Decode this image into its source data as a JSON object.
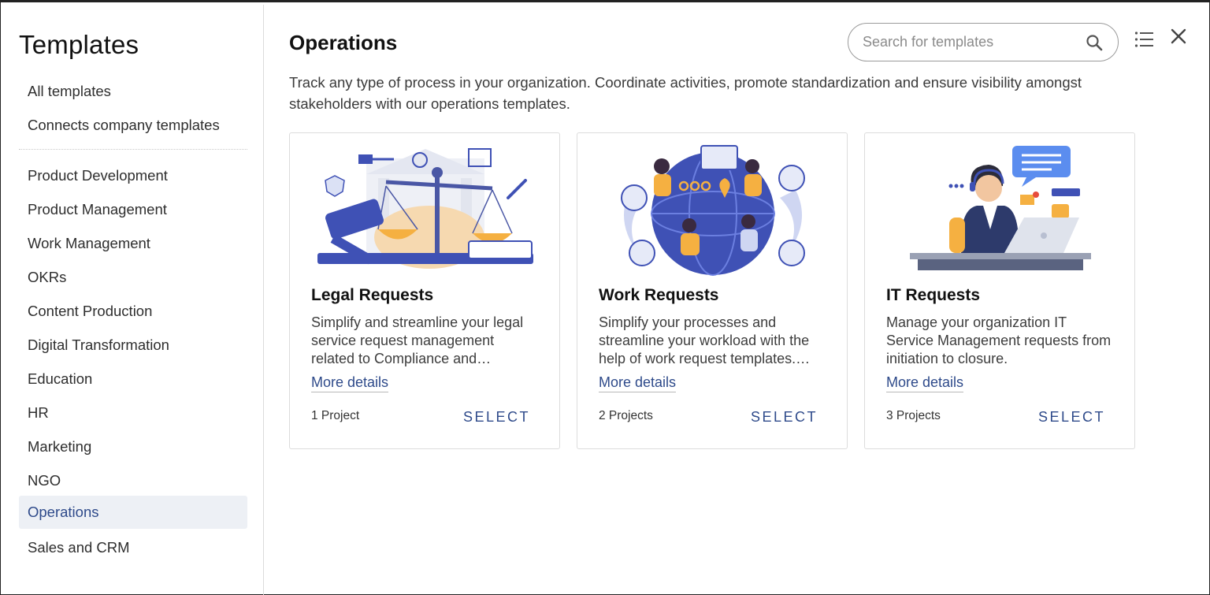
{
  "sidebar": {
    "title": "Templates",
    "top_items": [
      {
        "label": "All templates"
      },
      {
        "label": "Connects company templates"
      }
    ],
    "categories": [
      {
        "label": "Product Development"
      },
      {
        "label": "Product Management"
      },
      {
        "label": "Work Management"
      },
      {
        "label": "OKRs"
      },
      {
        "label": "Content Production"
      },
      {
        "label": "Digital Transformation"
      },
      {
        "label": "Education"
      },
      {
        "label": "HR"
      },
      {
        "label": "Marketing"
      },
      {
        "label": "NGO"
      },
      {
        "label": "Operations",
        "active": true
      },
      {
        "label": "Sales and CRM"
      }
    ]
  },
  "main": {
    "title": "Operations",
    "description": "Track any type of process in your organization. Coordinate activities, promote standardization and ensure visibility amongst stakeholders with our operations templates.",
    "search": {
      "placeholder": "Search for templates",
      "icon": "search-icon"
    },
    "toolbar": {
      "list_icon": "list-view-icon",
      "close_icon": "close-icon"
    },
    "cards": [
      {
        "title": "Legal Requests",
        "description": "Simplify and streamline your legal service request management related to Compliance and…",
        "more_details": "More details",
        "projects": "1 Project",
        "select_label": "SELECT",
        "illustration": "legal-scales-illustration"
      },
      {
        "title": "Work Requests",
        "description": "Simplify your processes and streamline your workload with the help of work request templates.…",
        "more_details": "More details",
        "projects": "2 Projects",
        "select_label": "SELECT",
        "illustration": "globe-team-illustration"
      },
      {
        "title": "IT Requests",
        "description": "Manage your organization IT Service Management requests from initiation to closure.",
        "more_details": "More details",
        "projects": "3 Projects",
        "select_label": "SELECT",
        "illustration": "support-agent-illustration"
      }
    ]
  },
  "colors": {
    "accent": "#2e4a8a",
    "active_bg": "#edf0f5",
    "illustration_blue": "#3f51b5",
    "illustration_orange": "#f5b041"
  }
}
